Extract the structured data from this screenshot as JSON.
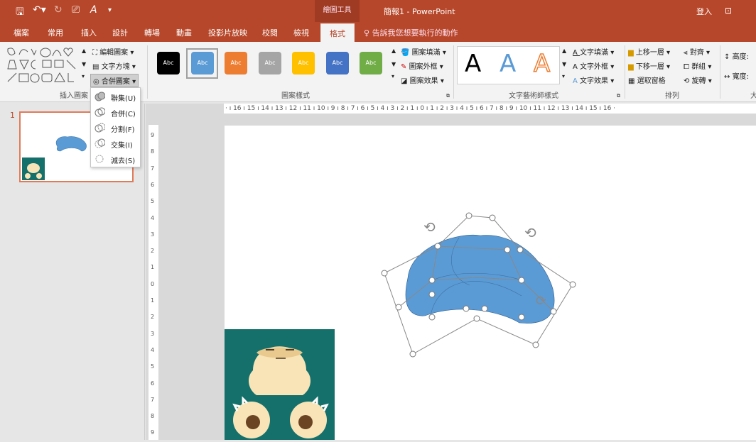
{
  "titlebar": {
    "drawing_tools": "繪圖工具",
    "doc_title": "簡報1 - PowerPoint",
    "sign_in": "登入"
  },
  "tabs": {
    "file": "檔案",
    "home": "常用",
    "insert": "插入",
    "design": "設計",
    "transitions": "轉場",
    "animations": "動畫",
    "slideshow": "投影片放映",
    "review": "校閱",
    "view": "檢視",
    "format": "格式"
  },
  "tell_me": "告訴我您想要執行的動作",
  "ribbon": {
    "edit_shape": "編輯圖案",
    "text_box": "文字方塊",
    "merge_shapes": "合併圖案",
    "insert_shapes_label": "插入圖案",
    "shape_styles_label": "圖案樣式",
    "swatch_text": "Abc",
    "shape_fill": "圖案填滿",
    "shape_outline": "圖案外框",
    "shape_effects": "圖案效果",
    "wordart_letter": "A",
    "text_fill": "文字填滿",
    "text_outline": "文字外框",
    "text_effects": "文字效果",
    "wordart_label": "文字藝術師樣式",
    "bring_forward": "上移一層",
    "send_backward": "下移一層",
    "selection_pane": "選取窗格",
    "align": "對齊",
    "group": "群組",
    "rotate": "旋轉",
    "arrange_label": "排列",
    "height": "高度:",
    "width": "寬度:",
    "size_label": "大"
  },
  "merge_menu": [
    "聯集(U)",
    "合併(C)",
    "分割(F)",
    "交集(I)",
    "減去(S)"
  ],
  "slide_panel": {
    "number": "1"
  },
  "ruler": {
    "horizontal": "· ı 16 ı 15 ı 14 ı 13 ı 12 ı 11 ı 10 ı 9 ı 8 ı 7 ı 6 ı 5 ı 4 ı 3 ı 2 ı 1 ı 0 ı 1 ı 2 ı 3 ı 4 ı 5 ı 6 ı 7 ı 8 ı 9 ı 10 ı 11 ı 12 ı 13 ı 14 ı 15 ı 16 ·",
    "vertical": [
      "9",
      "8",
      "7",
      "6",
      "5",
      "4",
      "3",
      "2",
      "1",
      "0",
      "1",
      "2",
      "3",
      "4",
      "5",
      "6",
      "7",
      "8",
      "9"
    ]
  },
  "colors": {
    "accent": "#b7472a",
    "swatches": [
      "#000000",
      "#5b9bd5",
      "#ed7d31",
      "#a5a5a5",
      "#ffc000",
      "#4472c4",
      "#70ad47"
    ],
    "shape_fill": "#5b9bd5",
    "snorlax_bg": "#15706b"
  }
}
